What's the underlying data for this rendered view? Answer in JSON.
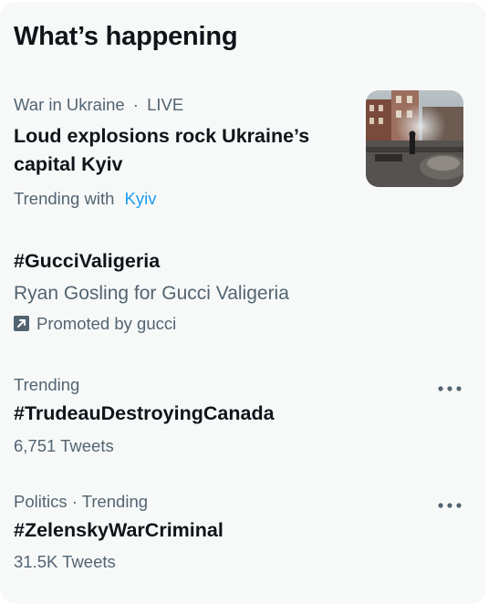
{
  "panel": {
    "title": "What’s happening"
  },
  "trends": [
    {
      "context_category": "War in Ukraine",
      "context_separator": "·",
      "context_status": "LIVE",
      "headline_line1": "Loud explosions rock Ukraine’s",
      "headline_line2": "capital Kyiv",
      "trending_with_label": "Trending with",
      "trending_with_link": "Kyiv",
      "image_icon": "news-photo-thumbnail"
    },
    {
      "title": "#GucciValigeria",
      "subtitle": "Ryan Gosling for Gucci Valigeria",
      "promoted_text": "Promoted by gucci",
      "promoted_icon": "promoted-arrow-icon"
    },
    {
      "context": "Trending",
      "title": "#TrudeauDestroyingCanada",
      "count": "6,751 Tweets",
      "more_icon": "more-dots-icon"
    },
    {
      "context": "Politics · Trending",
      "title": "#ZelenskyWarCriminal",
      "count": "31.5K Tweets",
      "more_icon": "more-dots-icon"
    }
  ],
  "colors": {
    "panel_background": "#f7f9f9",
    "primary_text": "#0f1419",
    "secondary_text": "#536471",
    "link_blue": "#1d9bf0"
  }
}
